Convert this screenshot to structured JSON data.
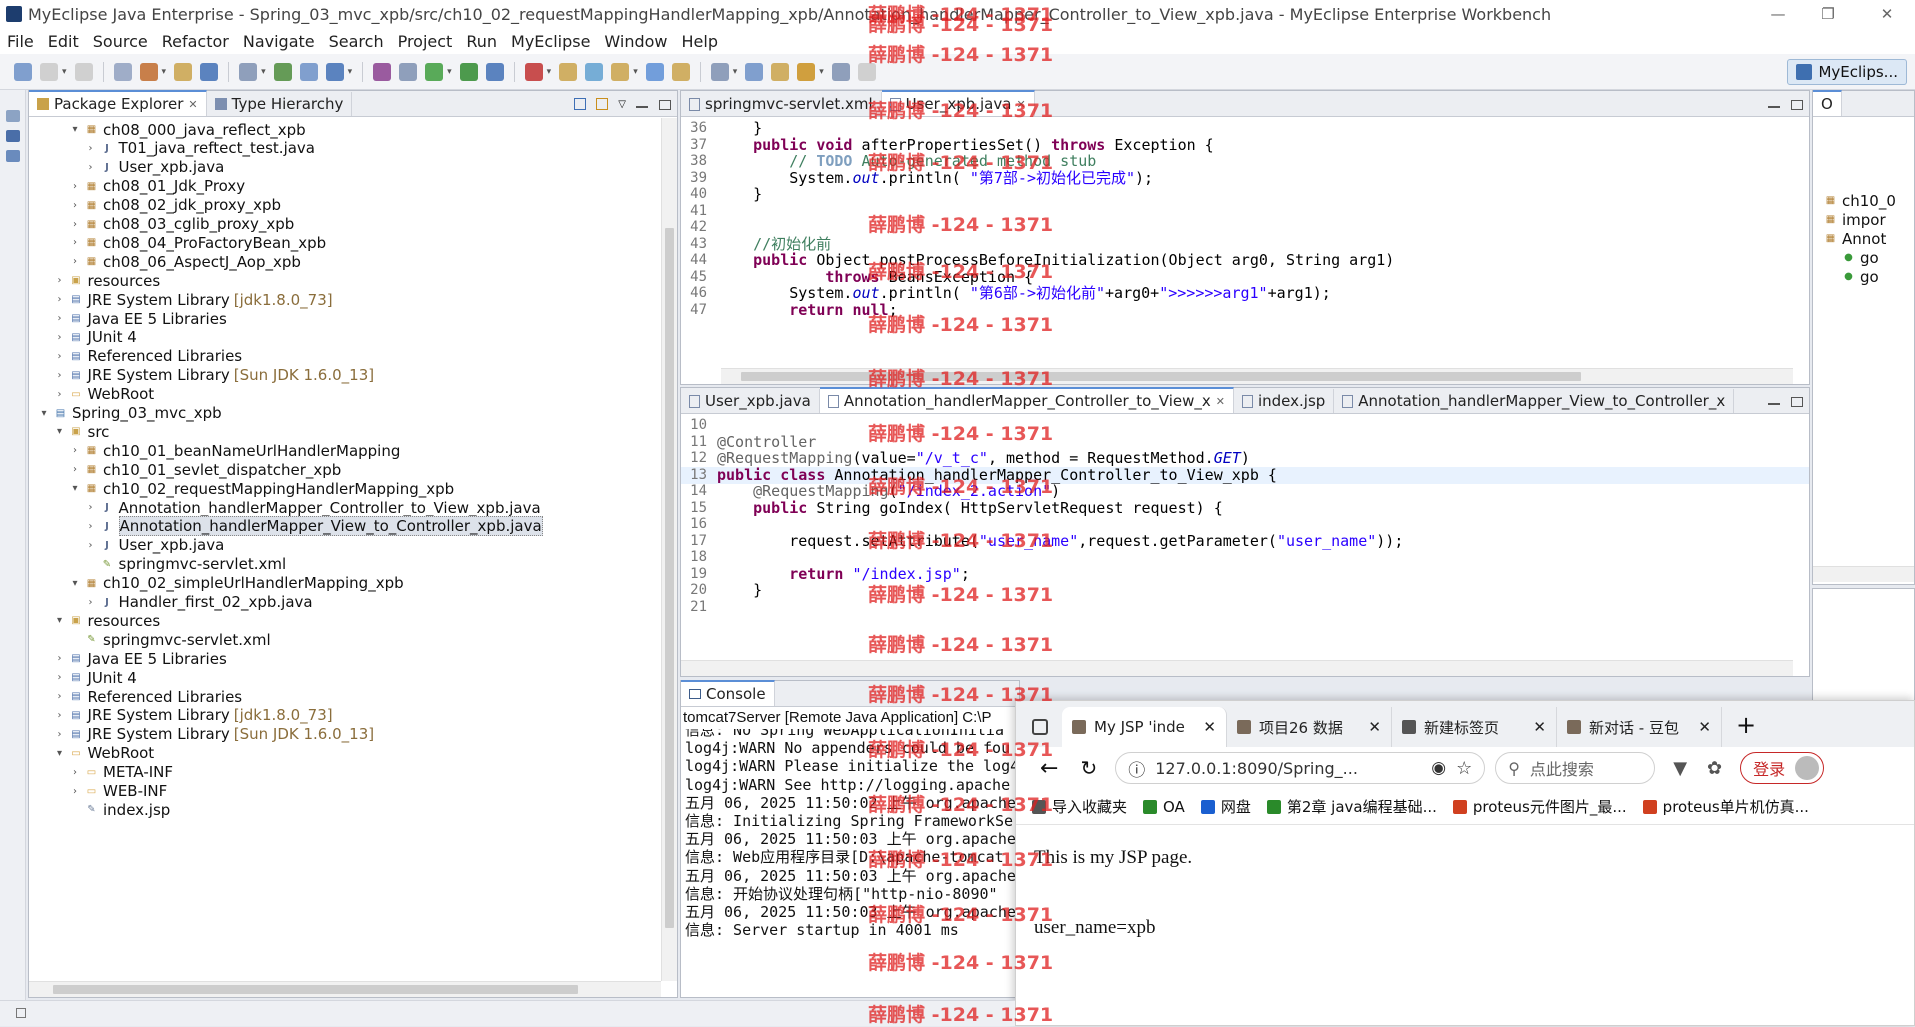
{
  "window": {
    "title": "MyEclipse Java Enterprise - Spring_03_mvc_xpb/src/ch10_02_requestMappingHandlerMapping_xpb/Annotation_handlerMapper_Controller_to_View_xpb.java - MyEclipse Enterprise Workbench",
    "minimize": "—",
    "maximize": "❐",
    "close": "✕"
  },
  "menu": [
    "File",
    "Edit",
    "Source",
    "Refactor",
    "Navigate",
    "Search",
    "Project",
    "Run",
    "MyEclipse",
    "Window",
    "Help"
  ],
  "toolbar": {
    "perspective_label": "MyEclips..."
  },
  "explorer": {
    "tab_package": "Package Explorer",
    "tab_hierarchy": "Type Hierarchy",
    "close_glyph": "✕",
    "items": [
      {
        "label": "ch08_000_java_reflect_xpb",
        "indent": 2,
        "tw": "▾",
        "icon": "package"
      },
      {
        "label": "T01_java_reftect_test.java",
        "indent": 3,
        "tw": "›",
        "icon": "java"
      },
      {
        "label": "User_xpb.java",
        "indent": 3,
        "tw": "›",
        "icon": "java"
      },
      {
        "label": "ch08_01_Jdk_Proxy",
        "indent": 2,
        "tw": "›",
        "icon": "package"
      },
      {
        "label": "ch08_02_jdk_proxy_xpb",
        "indent": 2,
        "tw": "›",
        "icon": "package"
      },
      {
        "label": "ch08_03_cglib_proxy_xpb",
        "indent": 2,
        "tw": "›",
        "icon": "package"
      },
      {
        "label": "ch08_04_ProFactoryBean_xpb",
        "indent": 2,
        "tw": "›",
        "icon": "package"
      },
      {
        "label": "ch08_06_AspectJ_Aop_xpb",
        "indent": 2,
        "tw": "›",
        "icon": "package"
      },
      {
        "label": "resources",
        "indent": 1,
        "tw": "›",
        "icon": "srcfolder"
      },
      {
        "label": "JRE System Library",
        "suffix": "[jdk1.8.0_73]",
        "indent": 1,
        "tw": "›",
        "icon": "lib"
      },
      {
        "label": "Java EE 5 Libraries",
        "indent": 1,
        "tw": "›",
        "icon": "lib"
      },
      {
        "label": "JUnit 4",
        "indent": 1,
        "tw": "›",
        "icon": "lib"
      },
      {
        "label": "Referenced Libraries",
        "indent": 1,
        "tw": "›",
        "icon": "lib"
      },
      {
        "label": "JRE System Library",
        "suffix": "[Sun JDK 1.6.0_13]",
        "indent": 1,
        "tw": "›",
        "icon": "lib"
      },
      {
        "label": "WebRoot",
        "indent": 1,
        "tw": "›",
        "icon": "folder"
      },
      {
        "label": "Spring_03_mvc_xpb",
        "indent": 0,
        "tw": "▾",
        "icon": "project"
      },
      {
        "label": "src",
        "indent": 1,
        "tw": "▾",
        "icon": "srcfolder"
      },
      {
        "label": "ch10_01_beanNameUrlHandlerMapping",
        "indent": 2,
        "tw": "›",
        "icon": "package"
      },
      {
        "label": "ch10_01_sevlet_dispatcher_xpb",
        "indent": 2,
        "tw": "›",
        "icon": "package"
      },
      {
        "label": "ch10_02_requestMappingHandlerMapping_xpb",
        "indent": 2,
        "tw": "▾",
        "icon": "package"
      },
      {
        "label": "Annotation_handlerMapper_Controller_to_View_xpb.java",
        "indent": 3,
        "tw": "›",
        "icon": "java"
      },
      {
        "label": "Annotation_handlerMapper_View_to_Controller_xpb.java",
        "indent": 3,
        "tw": "›",
        "icon": "java",
        "selected": true
      },
      {
        "label": "User_xpb.java",
        "indent": 3,
        "tw": "›",
        "icon": "java"
      },
      {
        "label": "springmvc-servlet.xml",
        "indent": 3,
        "tw": "",
        "icon": "xml"
      },
      {
        "label": "ch10_02_simpleUrlHandlerMapping_xpb",
        "indent": 2,
        "tw": "▾",
        "icon": "package"
      },
      {
        "label": "Handler_first_02_xpb.java",
        "indent": 3,
        "tw": "›",
        "icon": "java"
      },
      {
        "label": "resources",
        "indent": 1,
        "tw": "▾",
        "icon": "srcfolder"
      },
      {
        "label": "springmvc-servlet.xml",
        "indent": 2,
        "tw": "",
        "icon": "xml"
      },
      {
        "label": "Java EE 5 Libraries",
        "indent": 1,
        "tw": "›",
        "icon": "lib"
      },
      {
        "label": "JUnit 4",
        "indent": 1,
        "tw": "›",
        "icon": "lib"
      },
      {
        "label": "Referenced Libraries",
        "indent": 1,
        "tw": "›",
        "icon": "lib"
      },
      {
        "label": "JRE System Library",
        "suffix": "[jdk1.8.0_73]",
        "indent": 1,
        "tw": "›",
        "icon": "lib"
      },
      {
        "label": "JRE System Library",
        "suffix": "[Sun JDK 1.6.0_13]",
        "indent": 1,
        "tw": "›",
        "icon": "lib"
      },
      {
        "label": "WebRoot",
        "indent": 1,
        "tw": "▾",
        "icon": "folder"
      },
      {
        "label": "META-INF",
        "indent": 2,
        "tw": "›",
        "icon": "folder"
      },
      {
        "label": "WEB-INF",
        "indent": 2,
        "tw": "›",
        "icon": "folder"
      },
      {
        "label": "index.jsp",
        "indent": 2,
        "tw": "",
        "icon": "jsp"
      }
    ]
  },
  "editor_top": {
    "tabs": [
      {
        "label": "springmvc-servlet.xml",
        "active": false
      },
      {
        "label": "User_xpb.java",
        "active": true
      }
    ],
    "lines": [
      {
        "n": "36",
        "html": "    }"
      },
      {
        "n": "37",
        "html": "    <span class='kw'>public</span> <span class='kw'>void</span> afterPropertiesSet() <span class='kw'>throws</span> Exception {"
      },
      {
        "n": "38",
        "html": "        <span class='cm'>// <span class='todo'>TODO</span> Auto-generated method stub</span>"
      },
      {
        "n": "39",
        "html": "        System.<span class='ital'>out</span>.println( <span class='str'>\"第7部->初始化已完成\"</span>);"
      },
      {
        "n": "40",
        "html": "    }"
      },
      {
        "n": "41",
        "html": ""
      },
      {
        "n": "42",
        "html": ""
      },
      {
        "n": "43",
        "html": "    <span class='cm'>//初始化前</span>"
      },
      {
        "n": "44",
        "html": "    <span class='kw'>public</span> Object postProcessBeforeInitialization(Object arg0, String arg1)"
      },
      {
        "n": "45",
        "html": "            <span class='kw'>throws</span> BeansException {"
      },
      {
        "n": "46",
        "html": "        System.<span class='ital'>out</span>.println( <span class='str'>\"第6部->初始化前\"</span>+arg0+<span class='str'>\">>>>>>arg1\"</span>+arg1);"
      },
      {
        "n": "47",
        "html": "        <span class='kw'>return</span> <span class='kw'>null</span>;"
      }
    ]
  },
  "editor_bottom": {
    "tabs": [
      {
        "label": "User_xpb.java",
        "active": false
      },
      {
        "label": "Annotation_handlerMapper_Controller_to_View_x",
        "active": true
      },
      {
        "label": "index.jsp",
        "active": false
      },
      {
        "label": "Annotation_handlerMapper_View_to_Controller_x",
        "active": false
      }
    ],
    "lines": [
      {
        "n": "10",
        "html": ""
      },
      {
        "n": "11",
        "html": "<span class='ann'>@Controller</span>"
      },
      {
        "n": "12",
        "html": "<span class='ann'>@RequestMapping</span>(value=<span class='str'>\"/v_t_c\"</span>, method = RequestMethod.<span class='ital'>GET</span>)"
      },
      {
        "n": "13",
        "html": "<span class='kw'>public</span> <span class='kw'>class</span> Annotation_handlerMapper_Controller_to_View_xpb {"
      },
      {
        "n": "14",
        "html": "    <span class='ann'>@RequestMapping</span>(<span class='str'>\"/index_2.action\"</span>)"
      },
      {
        "n": "15",
        "html": "    <span class='kw'>public</span> String goIndex( HttpServletRequest request) {"
      },
      {
        "n": "16",
        "html": ""
      },
      {
        "n": "17",
        "html": "        request.setAttribute(<span class='str'>\"user_name\"</span>,request.getParameter(<span class='str'>\"user_name\"</span>));"
      },
      {
        "n": "18",
        "html": ""
      },
      {
        "n": "19",
        "html": "        <span class='kw'>return</span> <span class='str'>\"/index.jsp\"</span>;"
      },
      {
        "n": "20",
        "html": "    }"
      },
      {
        "n": "21",
        "html": ""
      }
    ]
  },
  "outline": {
    "tab_label": "O",
    "items": [
      "ch10_0",
      "impor",
      "Annot",
      "go",
      "go"
    ]
  },
  "console": {
    "tab_label": "Console",
    "header": "tomcat7Server [Remote Java Application] C:\\P",
    "lines": [
      "信息: No Spring WebApplicationInitia",
      "log4j:WARN No appenders could be fou",
      "log4j:WARN Please initialize the log4",
      "log4j:WARN See http://logging.apache",
      "五月 06, 2025 11:50:02 上午 org.apache",
      "信息: Initializing Spring FrameworkSe",
      "五月 06, 2025 11:50:03 上午 org.apache",
      "信息: Web应用程序目录[D:\\apache-tomcat",
      "五月 06, 2025 11:50:03 上午 org.apache",
      "信息: 开始协议处理句柄[\"http-nio-8090\"",
      "五月 06, 2025 11:50:03 上午 org.apache",
      "信息: Server startup in 4001 ms"
    ]
  },
  "browser": {
    "tabs": [
      {
        "label": "My JSP 'inde",
        "active": true
      },
      {
        "label": "项目26 数据",
        "active": false
      },
      {
        "label": "新建标签页",
        "active": false
      },
      {
        "label": "新对话 - 豆包",
        "active": false
      }
    ],
    "new_tab": "+",
    "url": "127.0.0.1:8090/Spring_...",
    "search_placeholder": "点此搜索",
    "login_label": "登录",
    "bookmarks": [
      "导入收藏夹",
      "OA",
      "网盘",
      "第2章 java编程基础...",
      "proteus元件图片_最...",
      "proteus单片机仿真..."
    ],
    "page_line1": "This is my JSP page.",
    "page_line2": "user_name=xpb"
  },
  "watermark": "薛鹏博 -124 - 1371",
  "colors": {
    "accent": "#5b8ed6",
    "keyword": "#7f0055",
    "string": "#2a00ff",
    "comment": "#3f7f5f",
    "watermark": "#e02020"
  }
}
